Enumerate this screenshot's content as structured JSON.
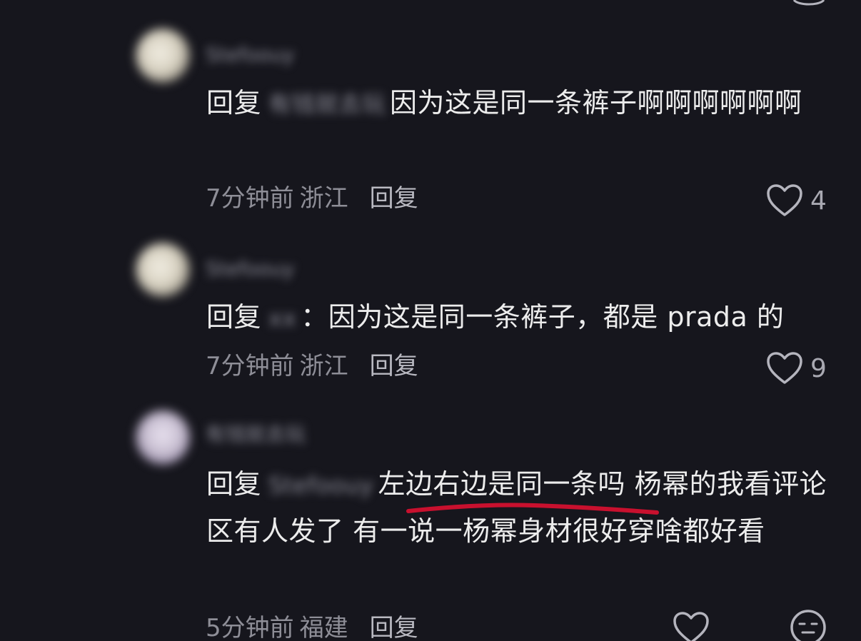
{
  "comments": [
    {
      "username": "Stefoouy",
      "mention": "有钱就去玩",
      "text": "因为这是同一条裤子啊啊啊啊啊啊",
      "reply_prefix": "回复",
      "time": "7分钟前",
      "location": "浙江",
      "reply_label": "回复",
      "likes": "4"
    },
    {
      "username": "Stefoouy",
      "mention": "xx",
      "text": "：因为这是同一条裤子，都是 prada 的",
      "reply_prefix": "回复",
      "time": "7分钟前",
      "location": "浙江",
      "reply_label": "回复",
      "likes": "9"
    },
    {
      "username": "有钱就去玩",
      "mention": "Stefoouy",
      "text_underlined": "左边右边是同一条吗",
      "text_rest": " 杨幂的我看评论区有人发了 有一说一杨幂身材很好穿啥都好看",
      "reply_prefix": "回复",
      "time": "5分钟前",
      "location": "福建",
      "reply_label": "回复"
    }
  ],
  "icons": {
    "like": "heart-outline-icon",
    "emoji": "neutral-face-icon"
  },
  "colors": {
    "background": "#16161d",
    "text": "#ececec",
    "meta": "#8e8e97",
    "underline_annotation": "#c8102e"
  }
}
